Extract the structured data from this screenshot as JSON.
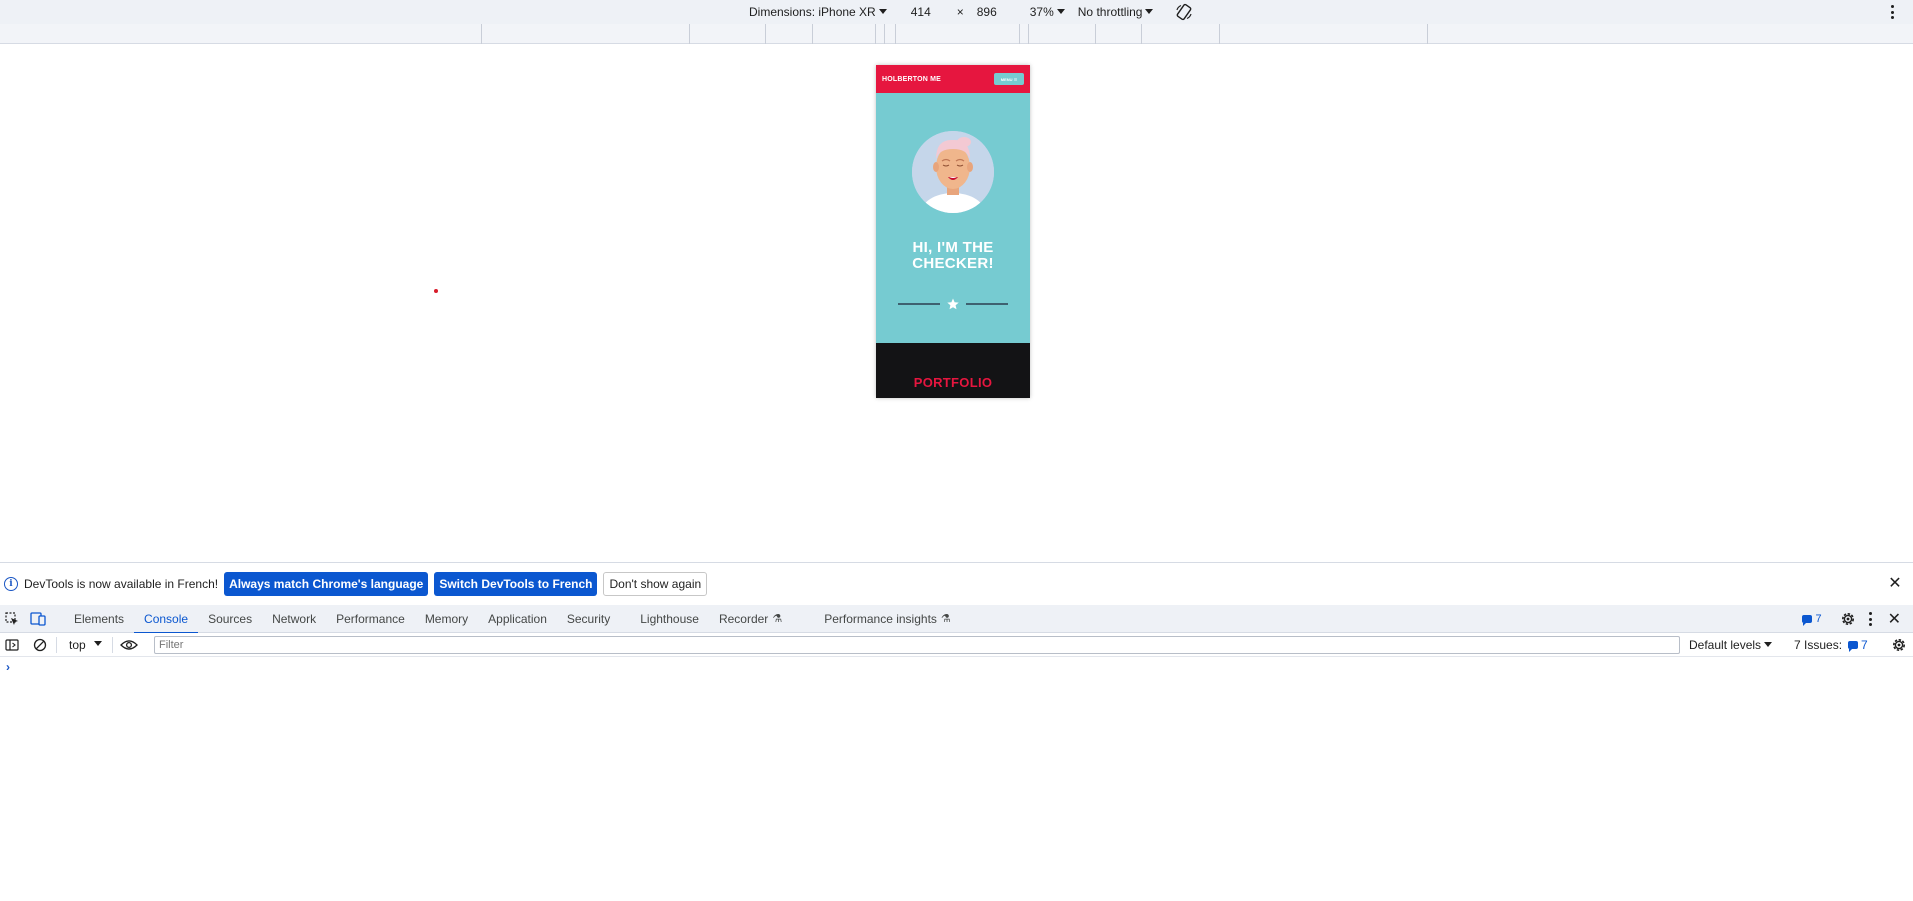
{
  "device_toolbar": {
    "dimensions_label": "Dimensions: iPhone XR",
    "width": "414",
    "times": "×",
    "height": "896",
    "zoom": "37%",
    "throttling": "No throttling"
  },
  "phone_page": {
    "brand": "HOLBERTON ME",
    "menu_label": "MENU ☰",
    "hero_title_line1": "HI, I'M THE",
    "hero_title_line2": "CHECKER!",
    "portfolio_title": "PORTFOLIO"
  },
  "notification": {
    "message": "DevTools is now available in French!",
    "btn_match": "Always match Chrome's language",
    "btn_switch": "Switch DevTools to French",
    "btn_dismiss": "Don't show again"
  },
  "devtools_tabs": [
    {
      "label": "Elements",
      "active": false
    },
    {
      "label": "Console",
      "active": true
    },
    {
      "label": "Sources",
      "active": false
    },
    {
      "label": "Network",
      "active": false
    },
    {
      "label": "Performance",
      "active": false
    },
    {
      "label": "Memory",
      "active": false
    },
    {
      "label": "Application",
      "active": false
    },
    {
      "label": "Security",
      "active": false
    },
    {
      "label": "Lighthouse",
      "active": false
    },
    {
      "label": "Recorder",
      "active": false
    },
    {
      "label": "Performance insights",
      "active": false
    }
  ],
  "issues_badge": "7",
  "console_toolbar": {
    "context": "top",
    "filter_placeholder": "Filter",
    "levels": "Default levels",
    "issues_label": "7 Issues:",
    "issues_count": "7"
  },
  "console_prompt": "›",
  "colors": {
    "brand_red": "#e6163f",
    "hero_teal": "#76cbd1",
    "devtools_blue": "#0b57d0"
  }
}
